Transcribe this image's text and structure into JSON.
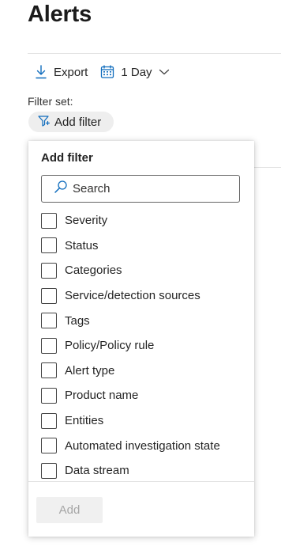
{
  "page": {
    "title": "Alerts"
  },
  "toolbar": {
    "export_label": "Export",
    "export_icon": "download-icon",
    "period_label": "1 Day",
    "period_icon": "calendar-icon",
    "period_chevron": "chevron-down-icon"
  },
  "filter_set": {
    "label": "Filter set:",
    "add_filter_label": "Add filter",
    "add_filter_icon": "filter-add-icon"
  },
  "panel": {
    "title": "Add filter",
    "search": {
      "value": "",
      "placeholder": "Search",
      "icon": "search-icon"
    },
    "options": [
      {
        "label": "Severity",
        "checked": false
      },
      {
        "label": "Status",
        "checked": false
      },
      {
        "label": "Categories",
        "checked": false
      },
      {
        "label": "Service/detection sources",
        "checked": false
      },
      {
        "label": "Tags",
        "checked": false
      },
      {
        "label": "Policy/Policy rule",
        "checked": false
      },
      {
        "label": "Alert type",
        "checked": false
      },
      {
        "label": "Product name",
        "checked": false
      },
      {
        "label": "Entities",
        "checked": false
      },
      {
        "label": "Automated investigation state",
        "checked": false
      },
      {
        "label": "Data stream",
        "checked": false
      }
    ],
    "add_button_label": "Add",
    "add_button_disabled": true
  },
  "colors": {
    "accent": "#0f6cbd",
    "pill_bg": "#eeeeee",
    "disabled_button_bg": "#f0f0f0",
    "disabled_button_text": "#a6a6a6"
  }
}
